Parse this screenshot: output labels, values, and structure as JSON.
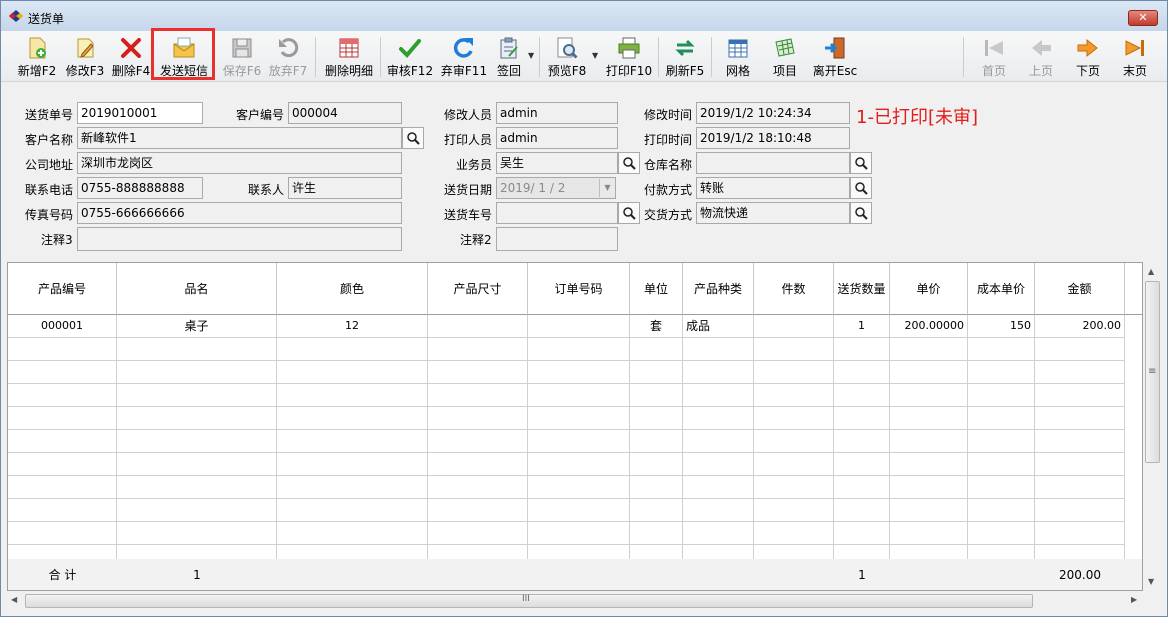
{
  "window": {
    "title": "送货单"
  },
  "toolbar": {
    "buttons": [
      {
        "label": "新增F2",
        "icon": "add-document-icon",
        "enabled": true
      },
      {
        "label": "修改F3",
        "icon": "edit-document-icon",
        "enabled": true
      },
      {
        "label": "删除F4",
        "icon": "delete-x-icon",
        "enabled": true
      },
      {
        "label": "发送短信",
        "icon": "sms-envelope-icon",
        "enabled": true
      },
      {
        "label": "保存F6",
        "icon": "save-disk-icon",
        "enabled": false
      },
      {
        "label": "放弃F7",
        "icon": "undo-icon",
        "enabled": false
      },
      {
        "label": "删除明细",
        "icon": "delete-detail-icon",
        "enabled": true
      },
      {
        "label": "审核F12",
        "icon": "approve-check-icon",
        "enabled": true
      },
      {
        "label": "弃审F11",
        "icon": "refresh-arrow-icon",
        "enabled": true
      },
      {
        "label": "签回",
        "icon": "clipboard-icon",
        "enabled": true
      },
      {
        "label": "预览F8",
        "icon": "preview-magnifier-icon",
        "enabled": true
      },
      {
        "label": "打印F10",
        "icon": "printer-icon",
        "enabled": true
      },
      {
        "label": "刷新F5",
        "icon": "swap-arrows-icon",
        "enabled": true
      },
      {
        "label": "网格",
        "icon": "grid-icon",
        "enabled": true
      },
      {
        "label": "项目",
        "icon": "project-table-icon",
        "enabled": true
      },
      {
        "label": "离开Esc",
        "icon": "exit-door-icon",
        "enabled": true
      }
    ],
    "nav": [
      {
        "label": "首页",
        "icon": "first-page-icon",
        "enabled": false
      },
      {
        "label": "上页",
        "icon": "prev-page-icon",
        "enabled": false
      },
      {
        "label": "下页",
        "icon": "next-page-icon",
        "enabled": true
      },
      {
        "label": "末页",
        "icon": "last-page-icon",
        "enabled": true
      }
    ]
  },
  "form": {
    "labels": {
      "order_no": "送货单号",
      "customer_no": "客户编号",
      "modifier": "修改人员",
      "modify_time": "修改时间",
      "customer_name": "客户名称",
      "printer": "打印人员",
      "print_time": "打印时间",
      "address": "公司地址",
      "salesman": "业务员",
      "warehouse": "仓库名称",
      "phone": "联系电话",
      "contact": "联系人",
      "delivery_date": "送货日期",
      "payment": "付款方式",
      "fax": "传真号码",
      "vehicle": "送货车号",
      "delivery_method": "交货方式",
      "note3": "注释3",
      "note2": "注释2"
    },
    "values": {
      "order_no": "2019010001",
      "customer_no": "000004",
      "modifier": "admin",
      "modify_time": "2019/1/2 10:24:34",
      "customer_name": "新峰软件1",
      "printer": "admin",
      "print_time": "2019/1/2 18:10:48",
      "address": "深圳市龙岗区",
      "salesman": "吴生",
      "warehouse": "",
      "phone": "0755-888888888",
      "contact": "许生",
      "delivery_date": "2019/ 1 / 2",
      "payment": "转账",
      "fax": "0755-666666666",
      "vehicle": "",
      "delivery_method": "物流快递",
      "note3": "",
      "note2": ""
    },
    "status_text": "1-已打印[未审]"
  },
  "grid": {
    "columns": [
      "产品编号",
      "品名",
      "颜色",
      "产品尺寸",
      "订单号码",
      "单位",
      "产品种类",
      "件数",
      "送货数量",
      "单价",
      "成本单价",
      "金额"
    ],
    "rows": [
      [
        "000001",
        "桌子",
        "12",
        "",
        "",
        "套",
        "成品",
        "",
        "1",
        "200.00000",
        "150",
        "200.00"
      ]
    ],
    "totals": {
      "label": "合 计",
      "count": "1",
      "qty": "1",
      "amount": "200.00"
    }
  },
  "scroll": {
    "h_grip": "III",
    "v_grip": "≡"
  }
}
